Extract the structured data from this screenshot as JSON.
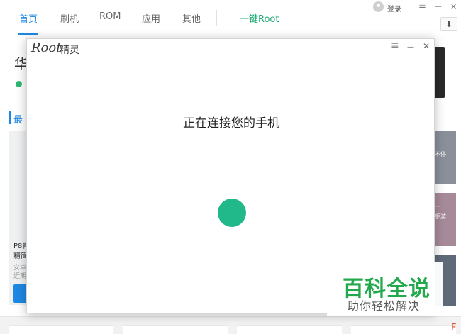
{
  "background_app": {
    "nav": {
      "items": [
        {
          "label": "首页",
          "active": true
        },
        {
          "label": "刷机",
          "active": false
        },
        {
          "label": "ROM",
          "active": false
        },
        {
          "label": "应用",
          "active": false
        },
        {
          "label": "其他",
          "active": false
        }
      ],
      "root_label": "一键Root"
    },
    "user": {
      "login_label": "登录"
    },
    "window_controls": {
      "menu": "≡",
      "minimize": "—",
      "close": "✕"
    },
    "download_icon": "⬇",
    "device_title_partial": "华",
    "section_title_partial": "最",
    "card": {
      "title_line1": "P8青",
      "title_line2": "精简",
      "sub_line1": "安卓",
      "sub_line2": "近期"
    },
    "thumb_captions": [
      "不停",
      "一",
      "手游"
    ]
  },
  "dialog": {
    "logo_script": "Root",
    "logo_cn": "精灵",
    "controls": {
      "menu": "≡",
      "minimize": "—",
      "close": "✕"
    },
    "message": "正在连接您的手机",
    "spinner_color": "#21b98a"
  },
  "watermark": {
    "main": "百科全说",
    "sub": "助你轻松解决",
    "corner": "F"
  },
  "colors": {
    "accent_blue": "#1e88e5",
    "root_green": "#1eab74",
    "watermark_green": "#23a94c"
  }
}
